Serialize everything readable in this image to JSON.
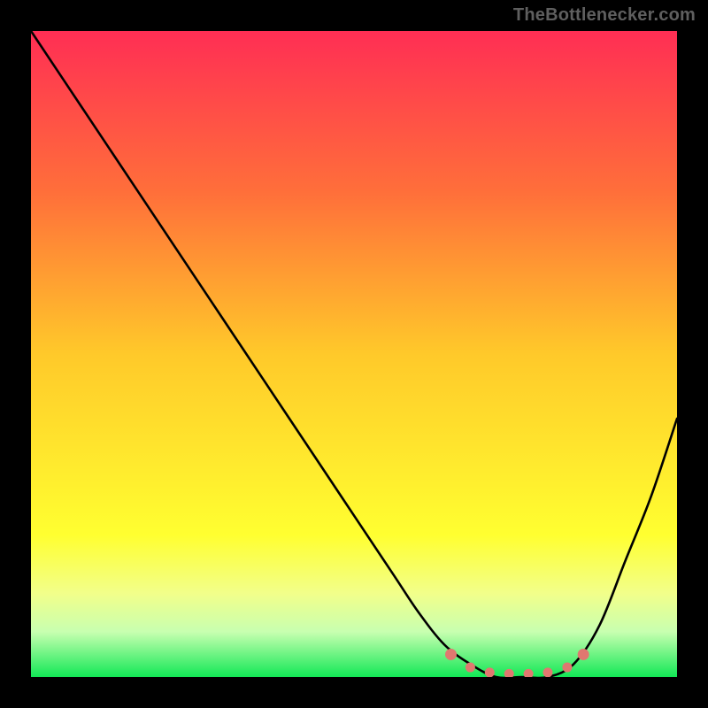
{
  "watermark": "TheBottlenecker.com",
  "chart_data": {
    "type": "line",
    "title": "",
    "xlabel": "",
    "ylabel": "",
    "xlim": [
      0,
      100
    ],
    "ylim": [
      0,
      100
    ],
    "grid": false,
    "legend": false,
    "series": [
      {
        "name": "bottleneck-curve",
        "color": "#000000",
        "x": [
          0,
          8,
          16,
          24,
          32,
          40,
          48,
          56,
          60,
          64,
          68,
          72,
          76,
          80,
          84,
          88,
          92,
          96,
          100
        ],
        "y": [
          100,
          88,
          76,
          64,
          52,
          40,
          28,
          16,
          10,
          5,
          2,
          0,
          0,
          0,
          2,
          8,
          18,
          28,
          40
        ]
      }
    ],
    "annotations": [
      {
        "name": "sweet-spot-dots",
        "color": "#E07870",
        "x": [
          65,
          68,
          71,
          74,
          77,
          80,
          83,
          85.5
        ],
        "y": [
          3.5,
          1.5,
          0.7,
          0.5,
          0.5,
          0.7,
          1.5,
          3.5
        ]
      }
    ],
    "background_gradient": {
      "stops": [
        {
          "offset": 0.0,
          "color": "#FF2E54"
        },
        {
          "offset": 0.25,
          "color": "#FF6F3A"
        },
        {
          "offset": 0.5,
          "color": "#FFC92A"
        },
        {
          "offset": 0.78,
          "color": "#FFFF30"
        },
        {
          "offset": 0.87,
          "color": "#F2FF8A"
        },
        {
          "offset": 0.93,
          "color": "#C8FFB0"
        },
        {
          "offset": 1.0,
          "color": "#12E856"
        }
      ]
    }
  }
}
